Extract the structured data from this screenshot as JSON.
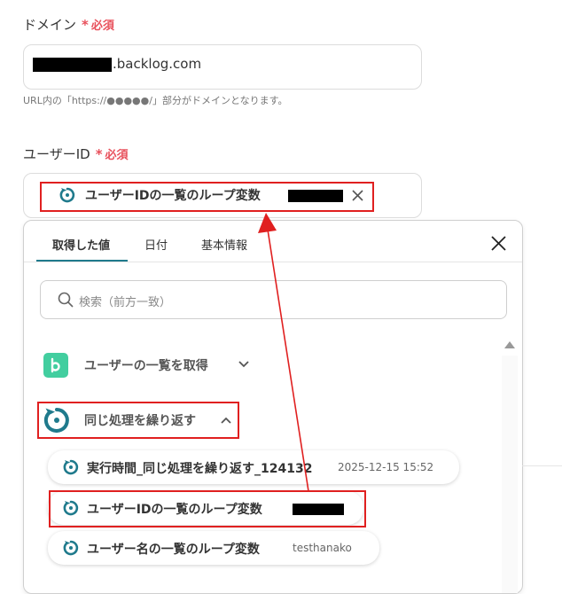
{
  "domain_field": {
    "label": "ドメイン",
    "required": "必須",
    "value_suffix": ".backlog.com",
    "help": "URL内の「https://●●●●●/」部分がドメインとなります。"
  },
  "userid_field": {
    "label": "ユーザーID",
    "required": "必須",
    "tag_label": "ユーザーIDの一覧のループ変数"
  },
  "dropdown": {
    "tabs": [
      {
        "label": "取得した値"
      },
      {
        "label": "日付"
      },
      {
        "label": "基本情報"
      }
    ],
    "search_placeholder": "検索（前方一致）",
    "sections": [
      {
        "label": "ユーザーの一覧を取得"
      },
      {
        "label": "同じ処理を繰り返す"
      }
    ],
    "items": [
      {
        "label": "実行時間_同じ処理を繰り返す_124132",
        "meta": "2025-12-15 15:52"
      },
      {
        "label": "ユーザーIDの一覧のループ変数",
        "meta": ""
      },
      {
        "label": "ユーザー名の一覧のループ変数",
        "meta": "testhanako"
      }
    ]
  },
  "icons": {
    "required_star": "asterisk-icon",
    "loop": "loop-icon",
    "backlog": "backlog-logo-icon",
    "search": "search-icon",
    "close": "close-icon",
    "chevron_down": "chevron-down-icon",
    "chevron_up": "chevron-up-icon",
    "scroll_up": "scroll-up-arrow-icon"
  },
  "colors": {
    "accent_teal": "#1f7a8c",
    "required_red": "#e8505b",
    "annotation_red": "#e02020",
    "backlog_green": "#42ce9f"
  }
}
